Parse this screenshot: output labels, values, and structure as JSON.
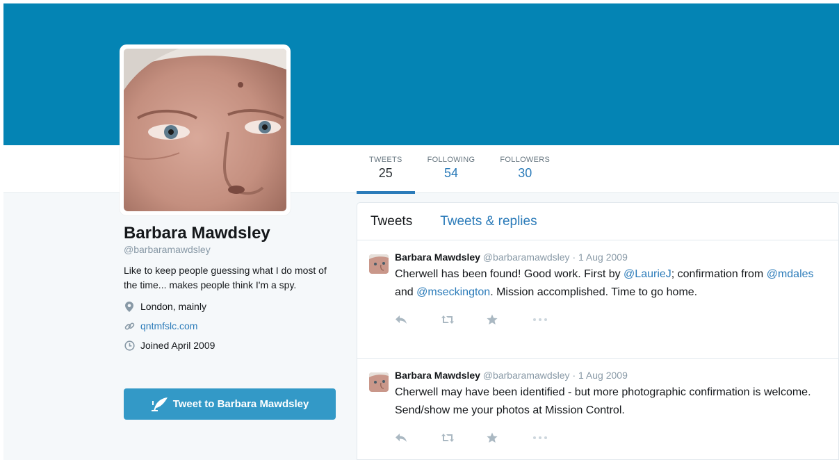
{
  "colors": {
    "banner": "#0484b4",
    "link": "#2b7bb9",
    "button": "#3399c7",
    "page_bg": "#f5f8fa"
  },
  "stats": [
    {
      "label": "TWEETS",
      "value": "25"
    },
    {
      "label": "FOLLOWING",
      "value": "54"
    },
    {
      "label": "FOLLOWERS",
      "value": "30"
    }
  ],
  "profile": {
    "name": "Barbara Mawdsley",
    "handle": "@barbaramawdsley",
    "bio": "Like to keep people guessing what I do most of the time... makes people think I'm a spy.",
    "location": "London, mainly",
    "website": "qntmfslc.com",
    "joined": "Joined April 2009",
    "tweet_to_label": "Tweet to Barbara Mawdsley"
  },
  "timeline": {
    "tabs": [
      "Tweets",
      "Tweets & replies"
    ],
    "tweets": [
      {
        "author": "Barbara Mawdsley",
        "handle": "@barbaramawdsley",
        "dot": "·",
        "time": "1 Aug 2009",
        "text_parts": [
          "Cherwell has been found! Good work. First by ",
          "@LaurieJ",
          "; confirmation from ",
          "@mdales",
          " and ",
          "@mseckington",
          ". Mission accomplished. Time to go home."
        ]
      },
      {
        "author": "Barbara Mawdsley",
        "handle": "@barbaramawdsley",
        "dot": "·",
        "time": "1 Aug 2009",
        "text": "Cherwell may have been identified - but more photographic confirmation is welcome. Send/show me your photos at Mission Control."
      }
    ]
  },
  "icons": {
    "location": "map-pin-icon",
    "website": "link-icon",
    "joined": "calendar-clock-icon",
    "tweet_to": "quill-icon",
    "reply": "reply-icon",
    "retweet": "retweet-icon",
    "favorite": "star-icon",
    "more": "more-icon"
  }
}
